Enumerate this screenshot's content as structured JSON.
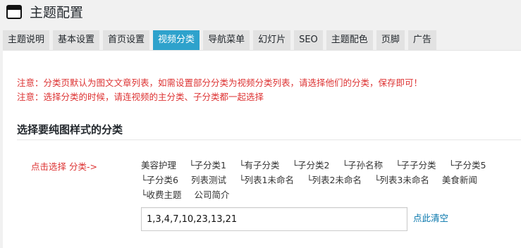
{
  "header": {
    "icon": "window-icon",
    "title": "主题配置"
  },
  "tabs": [
    {
      "label": "主题说明"
    },
    {
      "label": "基本设置"
    },
    {
      "label": "首页设置"
    },
    {
      "label": "视频分类",
      "active": true
    },
    {
      "label": "导航菜单"
    },
    {
      "label": "幻灯片"
    },
    {
      "label": "SEO"
    },
    {
      "label": "主题配色"
    },
    {
      "label": "页脚"
    },
    {
      "label": "广告"
    }
  ],
  "notice": {
    "line1": "注意：分类页默认为图文文章列表，如需设置部分分类为视频分类列表，请选择他们的分类，保存即可！",
    "line2": "注意：选择分类的时候，请连视频的主分类、子分类都一起选择"
  },
  "section": {
    "title": "选择要纯图样式的分类",
    "row_label": "点击选择 分类->",
    "categories": [
      "美容护理",
      "└子分类1",
      "└有子分类",
      "└子分类2",
      "└子孙名称",
      "└子子分类",
      "└子分类5",
      "└子分类6",
      "列表测试",
      "└列表1未命名",
      "└列表2未命名",
      "└列表3未命名",
      "美食新闻",
      "└收费主题",
      "公司简介"
    ],
    "input_value": "1,3,4,7,10,23,13,21",
    "clear_label": "点此清空"
  },
  "colors": {
    "accent": "#2ea2cc",
    "notice": "#dd3333",
    "link": "#0073aa"
  }
}
